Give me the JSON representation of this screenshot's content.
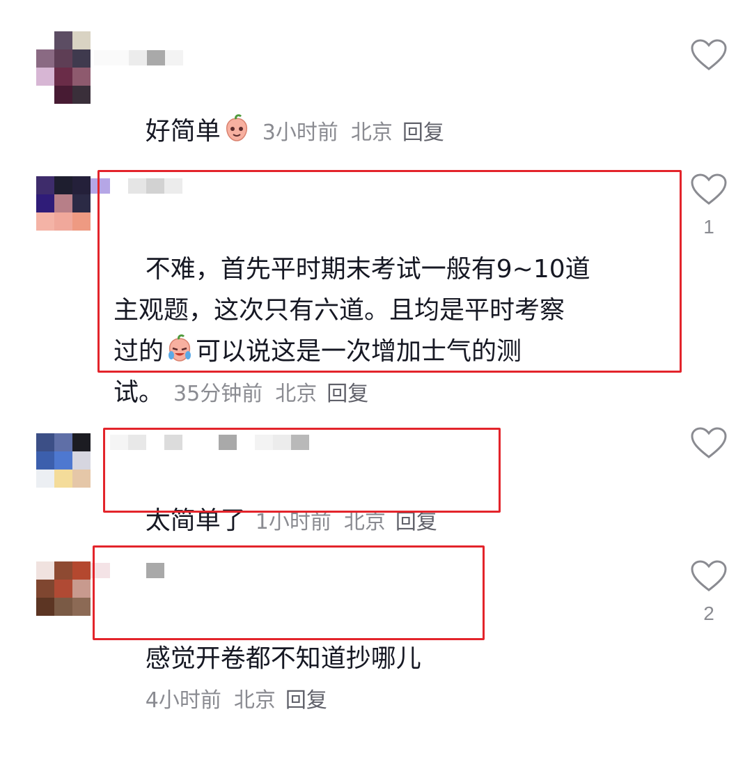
{
  "comments": [
    {
      "text": "好简单",
      "emoji": "peach-emoji",
      "time": "3小时前",
      "location": "北京",
      "reply": "回复",
      "like_icon": "heart-outline-icon",
      "likes": ""
    },
    {
      "text": "不难，首先平时期末考试一般有9~10道\n主观题，这次只有六道。且均是平时考察\n过的",
      "emoji": "crying-laughing-peach-emoji",
      "text_after_emoji": "可以说这是一次增加士气的测\n试。",
      "time": "35分钟前",
      "location": "北京",
      "reply": "回复",
      "like_icon": "heart-outline-icon",
      "likes": "1"
    },
    {
      "text": "太简单了",
      "time": "1小时前",
      "location": "北京",
      "reply": "回复",
      "like_icon": "heart-outline-icon",
      "likes": ""
    },
    {
      "text": "感觉开卷都不知道抄哪儿",
      "time": "4小时前",
      "location": "北京",
      "reply": "回复",
      "like_icon": "heart-outline-icon",
      "likes": "2"
    }
  ],
  "colors": {
    "text": "#161823",
    "meta": "#8a8b91",
    "highlight": "#e3242b"
  }
}
